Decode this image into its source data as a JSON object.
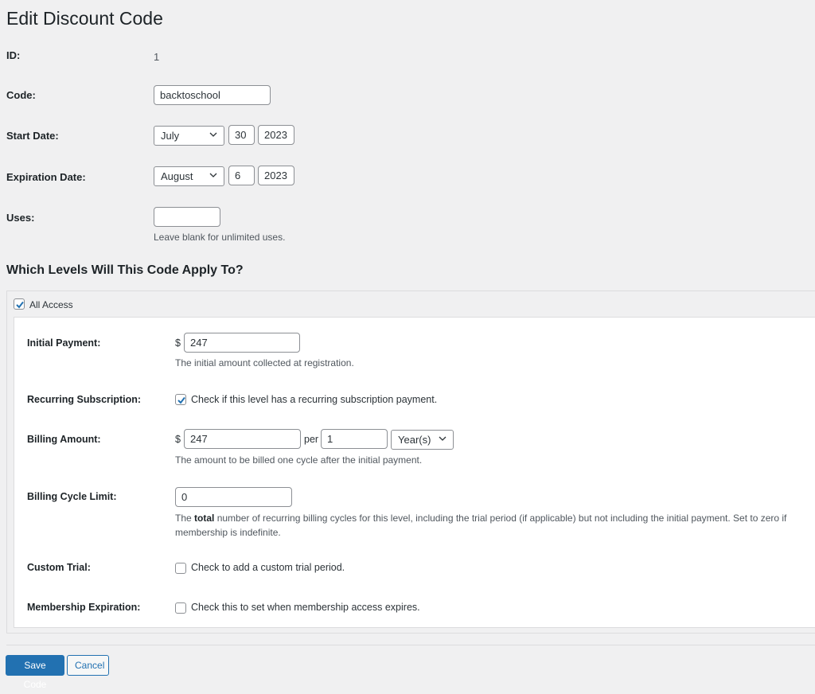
{
  "page": {
    "title": "Edit Discount Code"
  },
  "form": {
    "id": {
      "label": "ID:",
      "value": "1"
    },
    "code": {
      "label": "Code:",
      "value": "backtoschool"
    },
    "start_date": {
      "label": "Start Date:",
      "month": "July",
      "day": "30",
      "year": "2023"
    },
    "expiration_date": {
      "label": "Expiration Date:",
      "month": "August",
      "day": "6",
      "year": "2023"
    },
    "uses": {
      "label": "Uses:",
      "value": "",
      "description": "Leave blank for unlimited uses."
    }
  },
  "levels_section": {
    "title": "Which Levels Will This Code Apply To?",
    "levels": [
      {
        "name": "All Access",
        "checked": true,
        "initial_payment": {
          "label": "Initial Payment:",
          "currency": "$",
          "value": "247",
          "description": "The initial amount collected at registration."
        },
        "recurring": {
          "label": "Recurring Subscription:",
          "checked": true,
          "text": "Check if this level has a recurring subscription payment."
        },
        "billing_amount": {
          "label": "Billing Amount:",
          "currency": "$",
          "value": "247",
          "per_label": "per",
          "cycle_number": "1",
          "cycle_period": "Year(s)",
          "description": "The amount to be billed one cycle after the initial payment."
        },
        "billing_limit": {
          "label": "Billing Cycle Limit:",
          "value": "0",
          "description_pre": "The ",
          "description_bold": "total",
          "description_post": " number of recurring billing cycles for this level, including the trial period (if applicable) but not including the initial payment. Set to zero if membership is indefinite."
        },
        "custom_trial": {
          "label": "Custom Trial:",
          "checked": false,
          "text": "Check to add a custom trial period."
        },
        "expiration": {
          "label": "Membership Expiration:",
          "checked": false,
          "text": "Check this to set when membership access expires."
        }
      }
    ]
  },
  "actions": {
    "save_label": "Save Code",
    "cancel_label": "Cancel"
  },
  "colors": {
    "primary": "#2271b1",
    "background": "#f0f0f1",
    "check": "#2271b1"
  }
}
